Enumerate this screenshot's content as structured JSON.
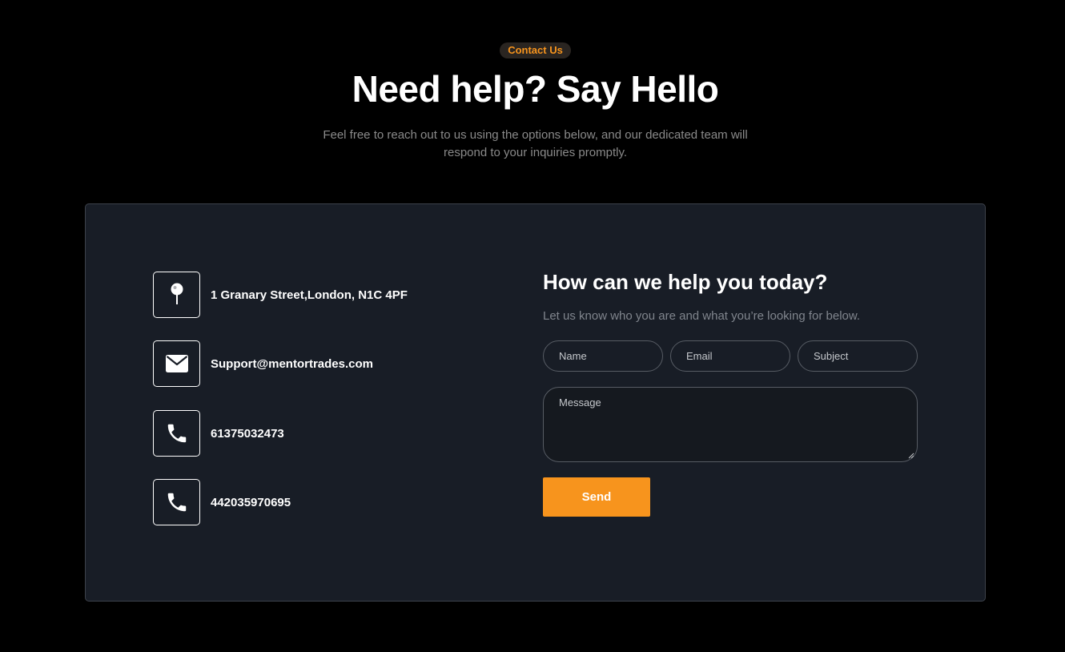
{
  "header": {
    "badge": "Contact Us",
    "title": "Need help? Say Hello",
    "subtitle": "Feel free to reach out to us using the options below, and our dedicated team will respond to your inquiries promptly."
  },
  "contact_info": {
    "address": "1 Granary Street,London, N1C 4PF",
    "email": "Support@mentortrades.com",
    "phone_1": "61375032473",
    "phone_2": "442035970695"
  },
  "form": {
    "title": "How can we help you today?",
    "description": "Let us know who you are and what you’re looking for below.",
    "name_placeholder": "Name",
    "email_placeholder": "Email",
    "subject_placeholder": "Subject",
    "message_placeholder": "Message",
    "send_label": "Send"
  },
  "colors": {
    "accent": "#f7941d",
    "card_background": "#181d26",
    "page_background": "#000000"
  },
  "icons": [
    "map-pin-icon",
    "envelope-icon",
    "phone-icon"
  ]
}
